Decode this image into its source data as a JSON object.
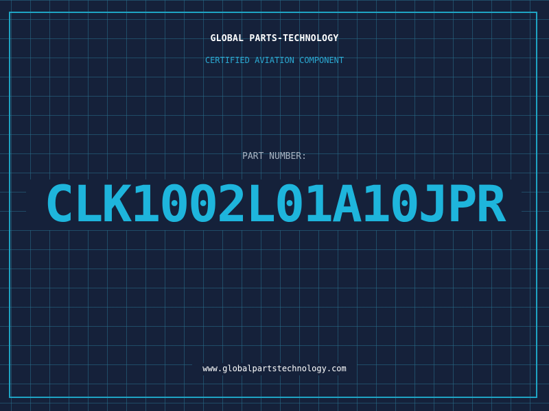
{
  "header": {
    "company": "GLOBAL PARTS-TECHNOLOGY",
    "subtitle": "CERTIFIED AVIATION COMPONENT"
  },
  "part": {
    "label": "PART NUMBER:",
    "number": "CLK1002L01A10JPR"
  },
  "footer": {
    "url": "www.globalpartstechnology.com"
  },
  "colors": {
    "background": "#15213a",
    "grid": "#296e8c",
    "frame": "#1fa4c4",
    "accent": "#1eb5dc",
    "subtitle": "#2ba9d2",
    "label": "#a8b4c2",
    "text": "#ffffff"
  }
}
